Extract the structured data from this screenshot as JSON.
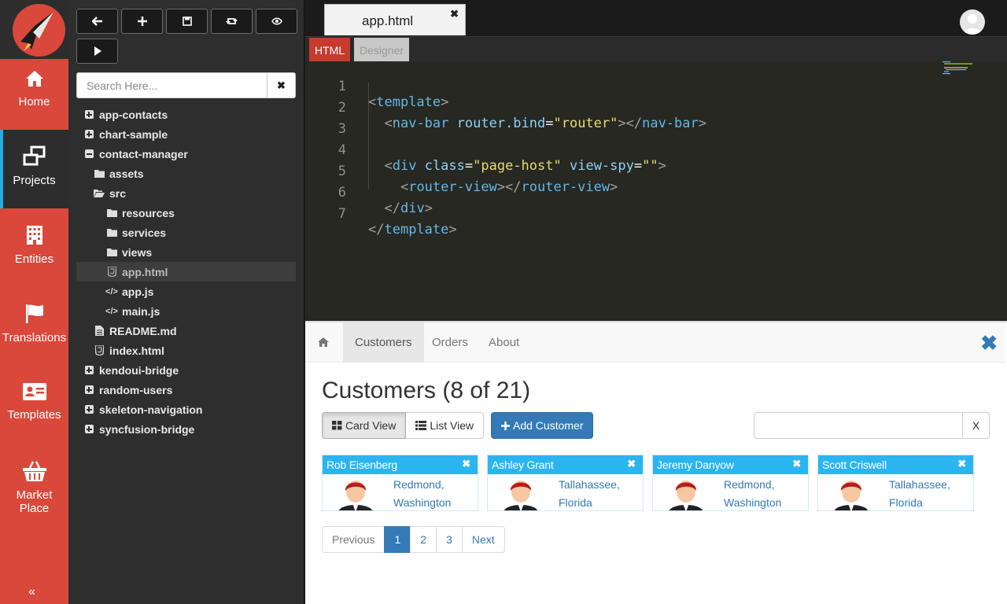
{
  "rail": {
    "items": [
      {
        "label": "Home",
        "icon": "home-icon"
      },
      {
        "label": "Projects",
        "icon": "projects-icon"
      },
      {
        "label": "Entities",
        "icon": "building-icon"
      },
      {
        "label": "Translations",
        "icon": "flag-icon"
      },
      {
        "label": "Templates",
        "icon": "id-card-icon"
      },
      {
        "label": "Market Place",
        "icon": "basket-icon"
      }
    ],
    "active": "Projects",
    "collapse_icon": "«"
  },
  "explorer": {
    "toolbar": [
      "back-icon",
      "add-icon",
      "save-icon",
      "refresh-icon",
      "preview-icon",
      "run-icon"
    ],
    "search_placeholder": "Search Here...",
    "tree": [
      {
        "label": "app-contacts",
        "type": "project",
        "state": "collapsed"
      },
      {
        "label": "chart-sample",
        "type": "project",
        "state": "collapsed"
      },
      {
        "label": "contact-manager",
        "type": "project",
        "state": "expanded"
      },
      {
        "label": "assets",
        "type": "folder"
      },
      {
        "label": "src",
        "type": "folder-open"
      },
      {
        "label": "resources",
        "type": "folder"
      },
      {
        "label": "services",
        "type": "folder"
      },
      {
        "label": "views",
        "type": "folder"
      },
      {
        "label": "app.html",
        "type": "html-file",
        "selected": true
      },
      {
        "label": "app.js",
        "type": "code-file"
      },
      {
        "label": "main.js",
        "type": "code-file"
      },
      {
        "label": "README.md",
        "type": "text-file"
      },
      {
        "label": "index.html",
        "type": "html-file"
      },
      {
        "label": "kendoui-bridge",
        "type": "project",
        "state": "collapsed"
      },
      {
        "label": "random-users",
        "type": "project",
        "state": "collapsed"
      },
      {
        "label": "skeleton-navigation",
        "type": "project",
        "state": "collapsed"
      },
      {
        "label": "syncfusion-bridge",
        "type": "project",
        "state": "collapsed"
      }
    ]
  },
  "editor": {
    "file_tab": "app.html",
    "modes": {
      "html": "HTML",
      "designer": "Designer"
    },
    "lines": [
      "1",
      "2",
      "3",
      "4",
      "5",
      "6",
      "7"
    ]
  },
  "preview": {
    "nav": {
      "customers": "Customers",
      "orders": "Orders",
      "about": "About"
    },
    "title": "Customers (8 of 21)",
    "card_view": "Card View",
    "list_view": "List View",
    "add_customer": "Add Customer",
    "filter_clear": "X",
    "cards": [
      {
        "name": "Rob Eisenberg",
        "city": "Redmond,",
        "state": "Washington"
      },
      {
        "name": "Ashley Grant",
        "city": "Tallahassee,",
        "state": "Florida"
      },
      {
        "name": "Jeremy Danyow",
        "city": "Redmond,",
        "state": "Washington"
      },
      {
        "name": "Scott Criswell",
        "city": "Tallahassee,",
        "state": "Florida"
      }
    ],
    "pager": {
      "prev": "Previous",
      "pages": [
        "1",
        "2",
        "3"
      ],
      "current": "1",
      "next": "Next"
    }
  },
  "colors": {
    "accent_red": "#d9483b",
    "active_blue": "#29aae1",
    "card_blue": "#2bb5f0",
    "link_blue": "#337ab7"
  }
}
